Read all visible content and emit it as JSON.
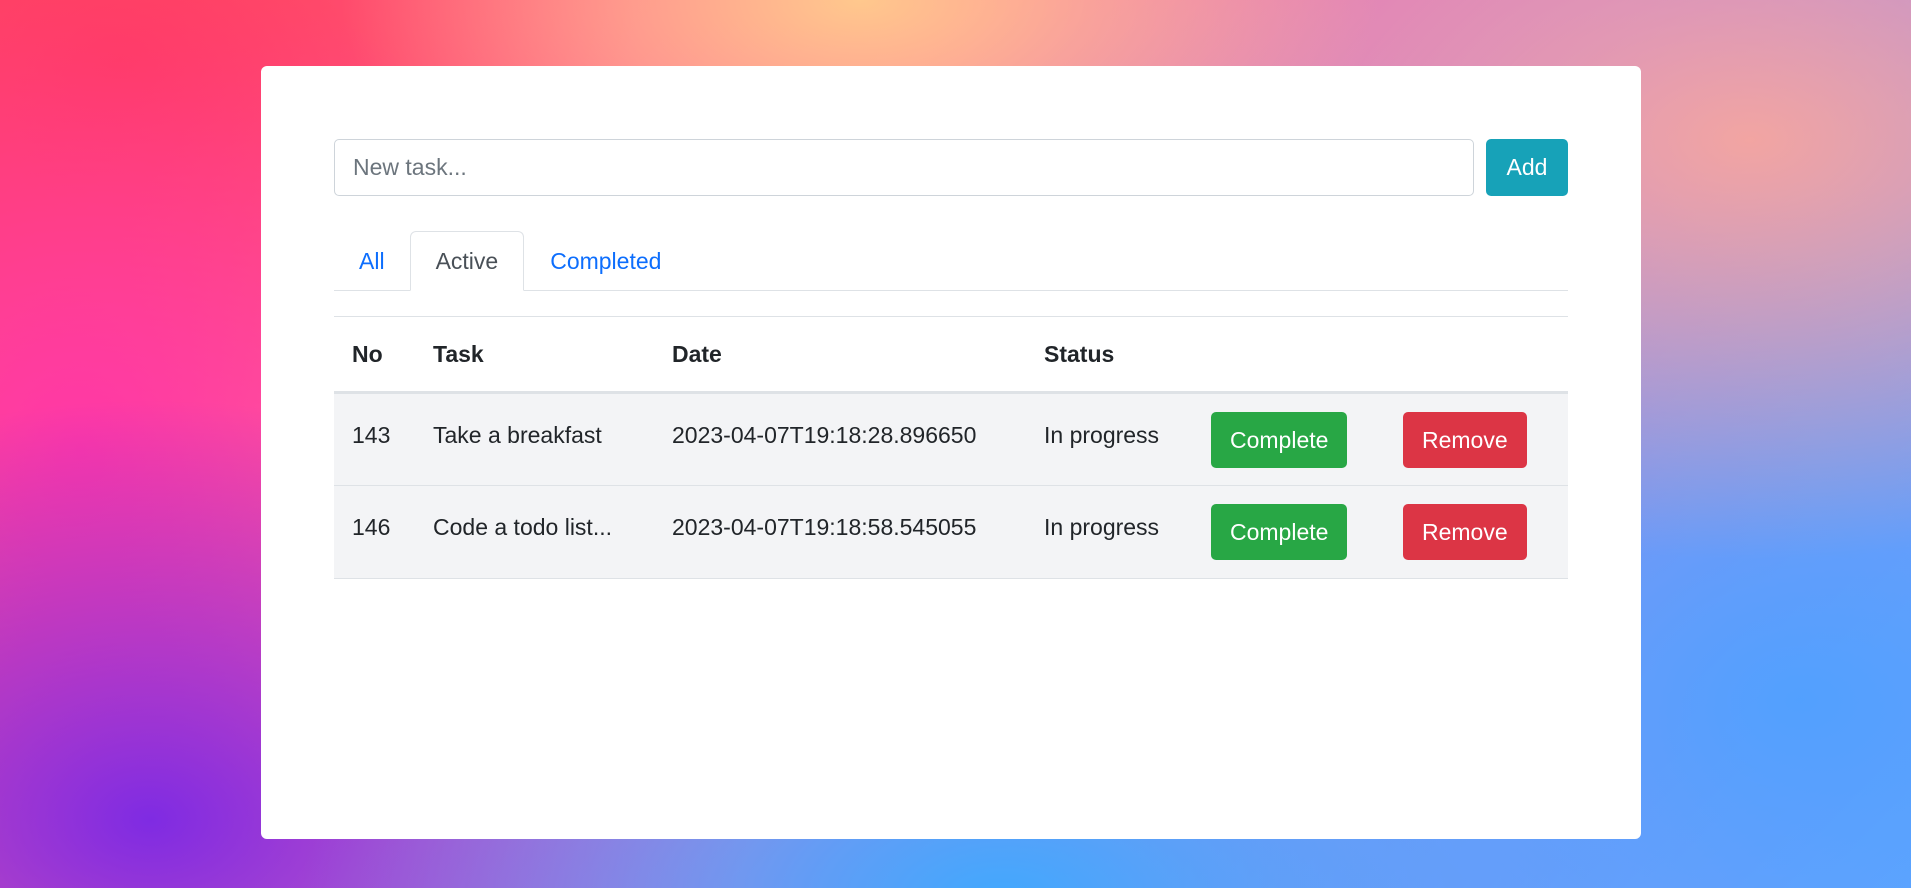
{
  "new_task": {
    "placeholder": "New task...",
    "value": "",
    "add_label": "Add"
  },
  "tabs": [
    {
      "label": "All",
      "active": false
    },
    {
      "label": "Active",
      "active": true
    },
    {
      "label": "Completed",
      "active": false
    }
  ],
  "table": {
    "headers": {
      "no": "No",
      "task": "Task",
      "date": "Date",
      "status": "Status"
    },
    "rows": [
      {
        "no": "143",
        "task": "Take a breakfast",
        "date": "2023-04-07T19:18:28.896650",
        "status": "In progress",
        "complete_label": "Complete",
        "remove_label": "Remove"
      },
      {
        "no": "146",
        "task": "Code a todo list...",
        "date": "2023-04-07T19:18:58.545055",
        "status": "In progress",
        "complete_label": "Complete",
        "remove_label": "Remove"
      }
    ]
  },
  "colors": {
    "add_button": "#17a2b8",
    "complete_button": "#28a745",
    "remove_button": "#dc3545",
    "tab_link": "#0d6efd",
    "row_background": "#f3f4f6"
  }
}
